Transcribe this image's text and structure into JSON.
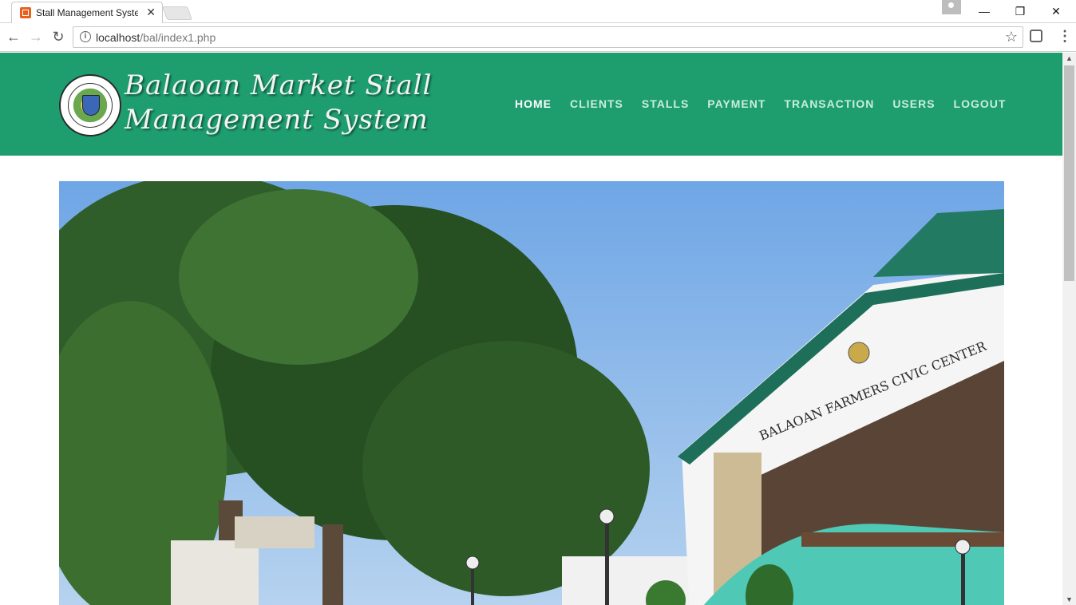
{
  "browser": {
    "tab_title": "Stall Management System",
    "url_host": "localhost",
    "url_path": "/bal/index1.php"
  },
  "site": {
    "brand_line1": "Balaoan Market Stall",
    "brand_line2": "Management System",
    "nav": [
      "HOME",
      "CLIENTS",
      "STALLS",
      "PAYMENT",
      "TRANSACTION",
      "USERS",
      "LOGOUT"
    ],
    "active_nav": "HOME"
  },
  "hero": {
    "sign_text": "BALAOAN FARMERS CIVIC CENTER"
  },
  "colors": {
    "header_green": "#1e9d6f",
    "nav_active": "#ffffff",
    "nav_inactive": "#c9eedd"
  }
}
